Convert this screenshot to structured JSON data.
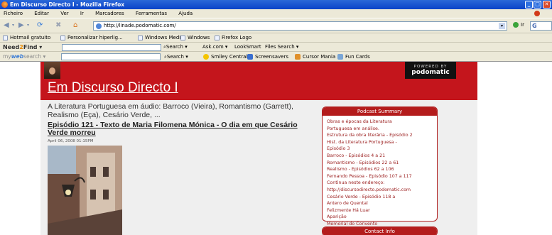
{
  "window": {
    "title": "Em Discurso Directo I - Mozilla Firefox",
    "buttons": [
      "_",
      "□",
      "✕"
    ]
  },
  "menu": [
    "Ficheiro",
    "Editar",
    "Ver",
    "Ir",
    "Marcadores",
    "Ferramentas",
    "Ajuda"
  ],
  "nav": {
    "url": "http://linade.podomatic.com/",
    "go_label": "Ir",
    "search_label": "G"
  },
  "bookmarks": [
    "Hotmail gratuito",
    "Personalizar hiperlig...",
    "Windows Media",
    "Windows",
    "Firefox Logo"
  ],
  "needtofind": {
    "logo_a": "Need",
    "logo_b": "2",
    "logo_c": "Find",
    "items": [
      "Search",
      "Ask.com",
      "LookSmart",
      "Files Search"
    ]
  },
  "mywebsearch": {
    "logo_a": "my",
    "logo_b": "web",
    "logo_c": "search",
    "items": [
      "Search",
      "Smiley Central",
      "Screensavers",
      "Cursor Mania",
      "Fun Cards"
    ]
  },
  "page": {
    "powered_by": "POWERED BY",
    "podomatic": "podomatic",
    "site_title": "Em Discurso Directo I",
    "tagline": "A Literatura Portuguesa em áudio: Barroco (Vieira), Romantismo (Garrett), Realismo (Eça), Cesário Verde, ...",
    "post_title": "Episódio 121 - Texto de Maria Filomena Mónica - O dia em que Cesário Verde morreu",
    "post_date": "April 06, 2008 01:15PM"
  },
  "sidebar": {
    "summary_title": "Podcast Summary",
    "summary_lines": [
      "Obras e épocas da Literatura",
      "Portuguesa em análise.",
      "Estrutura da obra literária - Episódio 2",
      "Hist. da Literatura Portuguesa -",
      "Episódio 3",
      "Barroco - Episódios 4 a 21",
      "Romantismo - Episódios 22 a 61",
      "Realismo - Episódios 62 a 106",
      "Fernando Pessoa - Episódio 107 a 117",
      "Continua neste endereço:",
      "http://discursodirecto.podomatic.com",
      "Cesário Verde - Episódio 118 a",
      "Antero de Quental",
      "Felizmente Há Luar",
      "Aparição",
      "Memorial do Convento"
    ],
    "contact_title": "Contact Info"
  },
  "colors": {
    "header_red": "#c4151c",
    "panel_red": "#b41c1c",
    "xp_blue": "#0a43c8"
  }
}
